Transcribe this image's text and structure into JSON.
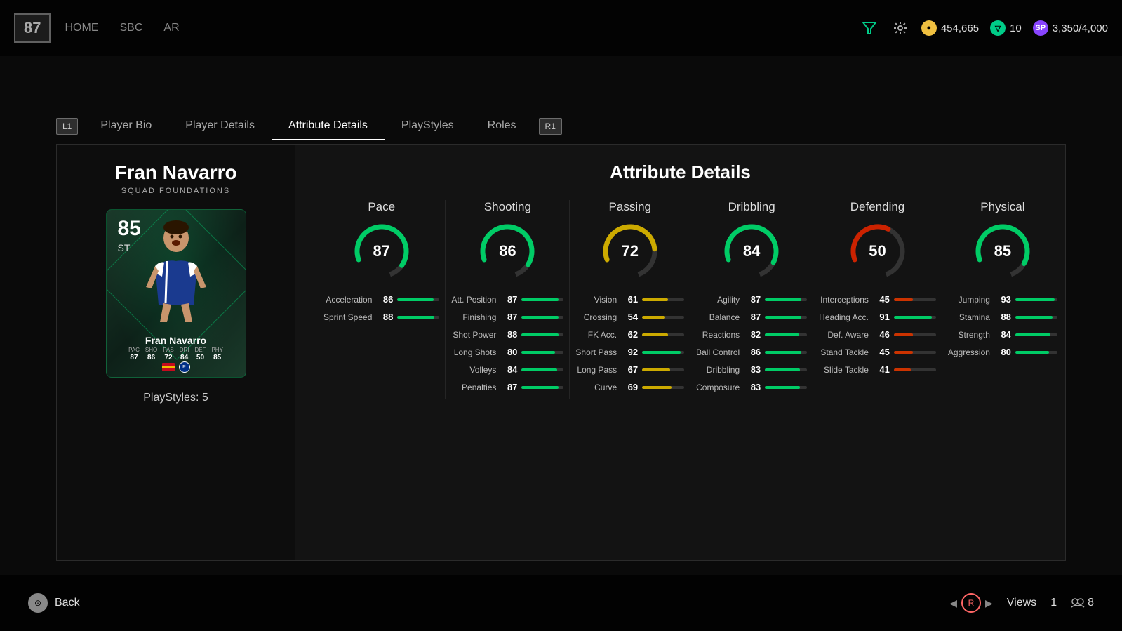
{
  "topbar": {
    "score": "87",
    "nav": [
      "HOME",
      "SBC",
      "AR"
    ],
    "coins": "454,665",
    "transfer": "10",
    "sp": "3,350/4,000"
  },
  "tabs": {
    "left_trigger": "L1",
    "right_trigger": "R1",
    "items": [
      {
        "label": "Player Bio",
        "active": false
      },
      {
        "label": "Player Details",
        "active": false
      },
      {
        "label": "Attribute Details",
        "active": true
      },
      {
        "label": "PlayStyles",
        "active": false
      },
      {
        "label": "Roles",
        "active": false
      }
    ]
  },
  "left_panel": {
    "player_name": "Fran Navarro",
    "squad_label": "SQUAD FOUNDATIONS",
    "card": {
      "rating": "85",
      "position": "ST",
      "player_name": "Fran Navarro",
      "stats": [
        {
          "label": "PAC",
          "value": "87"
        },
        {
          "label": "SHO",
          "value": "86"
        },
        {
          "label": "PAS",
          "value": "72"
        },
        {
          "label": "DRI",
          "value": "84"
        },
        {
          "label": "DEF",
          "value": "50"
        },
        {
          "label": "PHY",
          "value": "85"
        }
      ]
    },
    "playstyles": "PlayStyles: 5"
  },
  "attribute_details": {
    "title": "Attribute Details",
    "columns": [
      {
        "name": "Pace",
        "overall": 87,
        "color": "#00cc66",
        "stats": [
          {
            "name": "Acceleration",
            "value": 86,
            "color": "green"
          },
          {
            "name": "Sprint Speed",
            "value": 88,
            "color": "green"
          }
        ]
      },
      {
        "name": "Shooting",
        "overall": 86,
        "color": "#00cc66",
        "stats": [
          {
            "name": "Att. Position",
            "value": 87,
            "color": "green"
          },
          {
            "name": "Finishing",
            "value": 87,
            "color": "green"
          },
          {
            "name": "Shot Power",
            "value": 88,
            "color": "green"
          },
          {
            "name": "Long Shots",
            "value": 80,
            "color": "green"
          },
          {
            "name": "Volleys",
            "value": 84,
            "color": "green"
          },
          {
            "name": "Penalties",
            "value": 87,
            "color": "green"
          }
        ]
      },
      {
        "name": "Passing",
        "overall": 72,
        "color": "#888888",
        "stats": [
          {
            "name": "Vision",
            "value": 61,
            "color": "yellow"
          },
          {
            "name": "Crossing",
            "value": 54,
            "color": "yellow"
          },
          {
            "name": "FK Acc.",
            "value": 62,
            "color": "yellow"
          },
          {
            "name": "Short Pass",
            "value": 92,
            "color": "green"
          },
          {
            "name": "Long Pass",
            "value": 67,
            "color": "yellow"
          },
          {
            "name": "Curve",
            "value": 69,
            "color": "yellow"
          }
        ]
      },
      {
        "name": "Dribbling",
        "overall": 84,
        "color": "#00cc66",
        "stats": [
          {
            "name": "Agility",
            "value": 87,
            "color": "green"
          },
          {
            "name": "Balance",
            "value": 87,
            "color": "green"
          },
          {
            "name": "Reactions",
            "value": 82,
            "color": "green"
          },
          {
            "name": "Ball Control",
            "value": 86,
            "color": "green"
          },
          {
            "name": "Dribbling",
            "value": 83,
            "color": "green"
          },
          {
            "name": "Composure",
            "value": 83,
            "color": "green"
          }
        ]
      },
      {
        "name": "Defending",
        "overall": 50,
        "color": "#cc2200",
        "stats": [
          {
            "name": "Interceptions",
            "value": 45,
            "color": "red"
          },
          {
            "name": "Heading Acc.",
            "value": 91,
            "color": "green"
          },
          {
            "name": "Def. Aware",
            "value": 46,
            "color": "red"
          },
          {
            "name": "Stand Tackle",
            "value": 45,
            "color": "red"
          },
          {
            "name": "Slide Tackle",
            "value": 41,
            "color": "red"
          }
        ]
      },
      {
        "name": "Physical",
        "overall": 85,
        "color": "#00cc66",
        "stats": [
          {
            "name": "Jumping",
            "value": 93,
            "color": "green"
          },
          {
            "name": "Stamina",
            "value": 88,
            "color": "green"
          },
          {
            "name": "Strength",
            "value": 84,
            "color": "green"
          },
          {
            "name": "Aggression",
            "value": 80,
            "color": "green"
          }
        ]
      }
    ]
  },
  "bottom_bar": {
    "back_label": "Back",
    "views_label": "Views",
    "page_number": "1",
    "group_count": "8"
  }
}
